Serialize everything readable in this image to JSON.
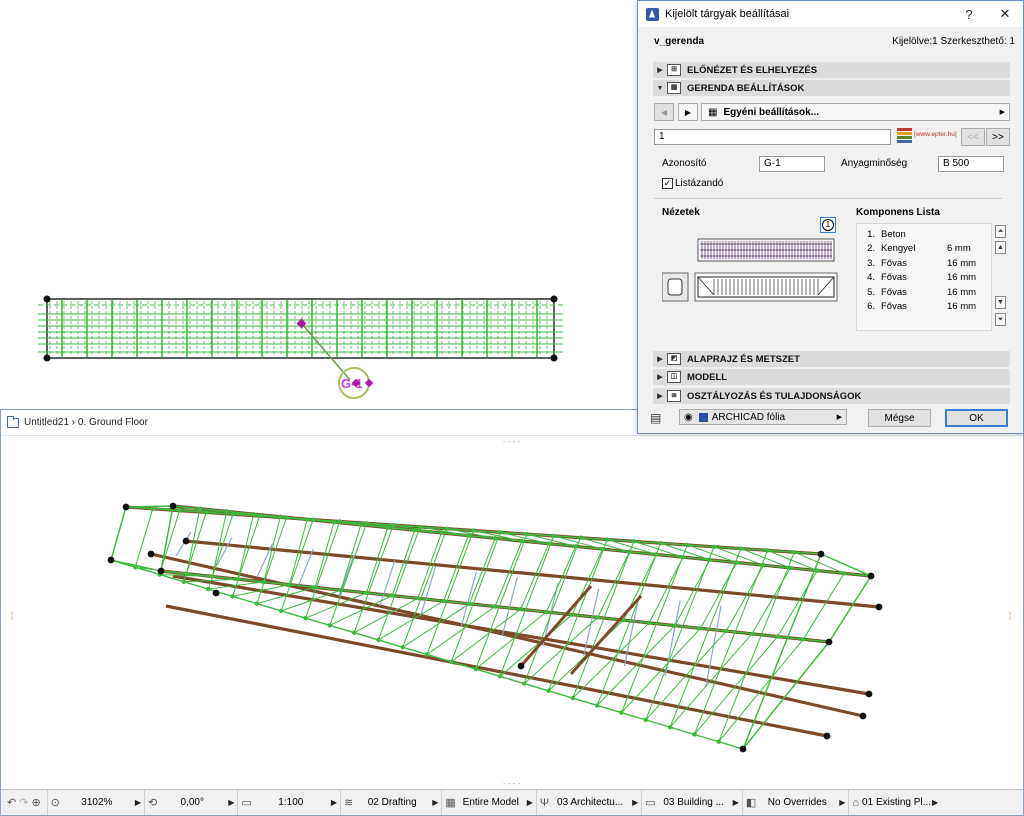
{
  "plan": {
    "beam_tag": "G-1"
  },
  "window3d": {
    "breadcrumb": "Untitled21 › 0. Ground Floor"
  },
  "statusbar": {
    "zoom": "3102%",
    "angle": "0,00°",
    "scale": "1:100",
    "layer_combo": "02 Drafting",
    "model_view": "Entire Model",
    "pen_set": "03 Architectu...",
    "mvo": "03 Building ...",
    "overrides": "No Overrides",
    "renovation": "01 Existing Pl..."
  },
  "dialog": {
    "title": "Kijelölt tárgyak beállításai",
    "help_label": "?",
    "close_label": "✕",
    "element_name": "v_gerenda",
    "selection_info": "Kijelölve:1 Szerkeszthető: 1",
    "sections": {
      "preview": "ELŐNÉZET ÉS ELHELYEZÉS",
      "beam_settings": "GERENDA BEÁLLÍTÁSOK",
      "floorplan": "ALAPRAJZ ÉS METSZET",
      "model": "MODELL",
      "classification": "OSZTÁLYOZÁS ÉS TULAJDONSÁGOK"
    },
    "custom_settings": "Egyéni beállítások...",
    "number_value": "1",
    "logo_text": "[www.epter.hu]",
    "prev_btn": "<<",
    "next_btn": ">>",
    "id_label": "Azonosító",
    "id_value": "G-1",
    "material_label": "Anyagminőség",
    "material_value": "B 500",
    "listable_label": "Listázandó",
    "views_label": "Nézetek",
    "badge": "1",
    "component_list_label": "Komponens Lista",
    "components": [
      {
        "n": "1.",
        "name": "Beton",
        "size": ""
      },
      {
        "n": "2.",
        "name": "Kengyel",
        "size": "6 mm"
      },
      {
        "n": "3.",
        "name": "Fővas",
        "size": "16 mm"
      },
      {
        "n": "4.",
        "name": "Fővas",
        "size": "16 mm"
      },
      {
        "n": "5.",
        "name": "Fővas",
        "size": "16 mm"
      },
      {
        "n": "6.",
        "name": "Fővas",
        "size": "16 mm"
      }
    ],
    "layer_value": "ARCHICAD fólia",
    "cancel_label": "Mégse",
    "ok_label": "OK"
  },
  "colors": {
    "rebar_green": "#3fb83f",
    "steel_brown": "#7a4a2a",
    "stirrup_blue": "#8aa8c8",
    "dialog_border": "#6b8fc2",
    "ok_border": "#3c7fd1"
  }
}
